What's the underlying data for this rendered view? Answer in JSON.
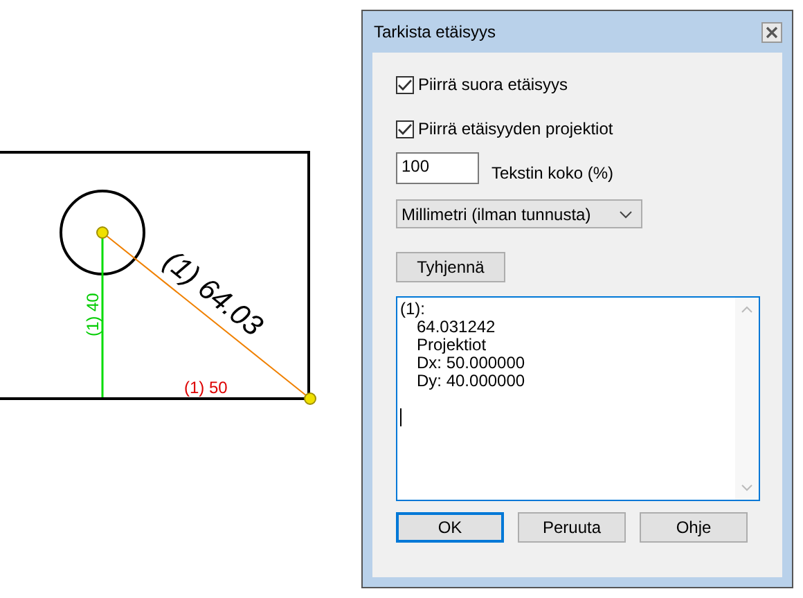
{
  "drawing": {
    "distance_label": "(1) 64.03",
    "dy_label": "(1) 40",
    "dx_label": "(1) 50"
  },
  "dialog": {
    "title": "Tarkista etäisyys",
    "checkboxes": [
      {
        "label": "Piirrä suora etäisyys",
        "checked": true
      },
      {
        "label": "Piirrä etäisyyden projektiot",
        "checked": true
      }
    ],
    "text_size": {
      "value": "100",
      "label": "Tekstin koko (%)"
    },
    "unit_select": {
      "value": "Millimetri (ilman tunnusta)"
    },
    "clear_button": "Tyhjennä",
    "result_lines": [
      {
        "text": "(1):",
        "indented": false
      },
      {
        "text": "64.031242",
        "indented": true
      },
      {
        "text": "Projektiot",
        "indented": true
      },
      {
        "text": "Dx: 50.000000",
        "indented": true
      },
      {
        "text": "Dy: 40.000000",
        "indented": true
      }
    ],
    "buttons": [
      {
        "label": "OK",
        "default": true
      },
      {
        "label": "Peruuta",
        "default": false
      },
      {
        "label": "Ohje",
        "default": false
      }
    ]
  }
}
